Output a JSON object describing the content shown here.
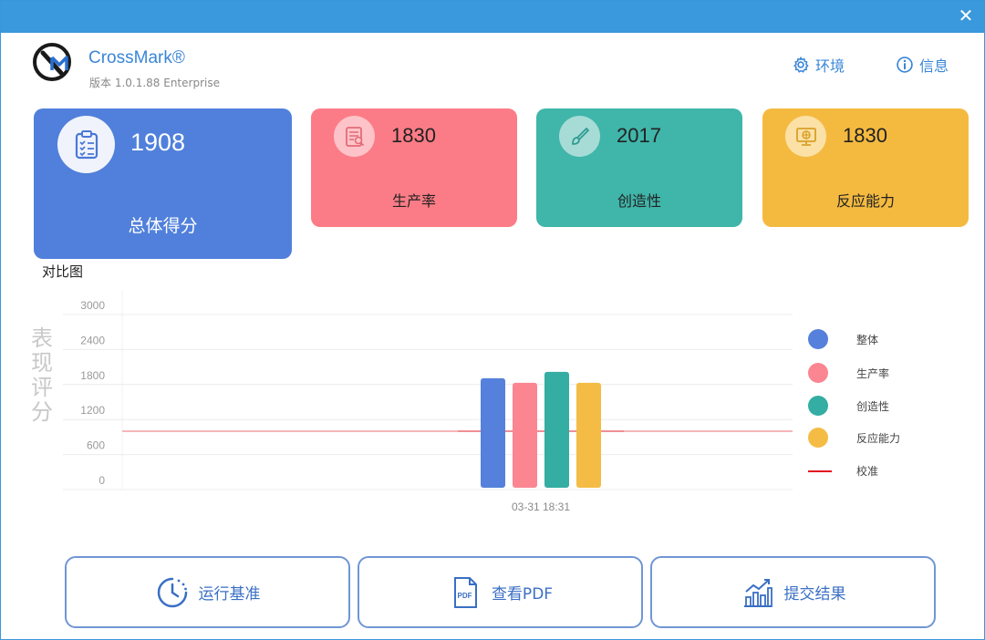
{
  "app": {
    "name": "CrossMark®",
    "version": "版本 1.0.1.88 Enterprise"
  },
  "header": {
    "env_label": "环境",
    "info_label": "信息"
  },
  "cards": {
    "total": {
      "value": "1908",
      "label": "总体得分",
      "color": "#5080db"
    },
    "productivity": {
      "value": "1830",
      "label": "生产率",
      "color": "#fb7c86"
    },
    "creativity": {
      "value": "2017",
      "label": "创造性",
      "color": "#40b5aa"
    },
    "responsiveness": {
      "value": "1830",
      "label": "反应能力",
      "color": "#f4ba40"
    }
  },
  "section_title": "对比图",
  "chart_data": {
    "type": "bar",
    "categories": [
      "03-31 18:31"
    ],
    "ylabel": "表现评分",
    "ylim": [
      0,
      3000
    ],
    "yticks": [
      "0",
      "600",
      "1200",
      "1800",
      "2400",
      "3000"
    ],
    "series": [
      {
        "name": "整体",
        "values": [
          1908
        ],
        "color": "#5580db"
      },
      {
        "name": "生产率",
        "values": [
          1830
        ],
        "color": "#fb8591"
      },
      {
        "name": "创造性",
        "values": [
          2017
        ],
        "color": "#34ada3"
      },
      {
        "name": "反应能力",
        "values": [
          1830
        ],
        "color": "#f4bc45"
      }
    ],
    "reference": {
      "name": "校准",
      "value": 1000,
      "color": "#e0141e"
    },
    "grid": true,
    "legend": "right"
  },
  "actions": {
    "run": "运行基准",
    "pdf": "查看PDF",
    "submit": "提交结果"
  },
  "icons": {
    "close": "close-icon",
    "env": "gear-icon",
    "info": "info-icon"
  }
}
